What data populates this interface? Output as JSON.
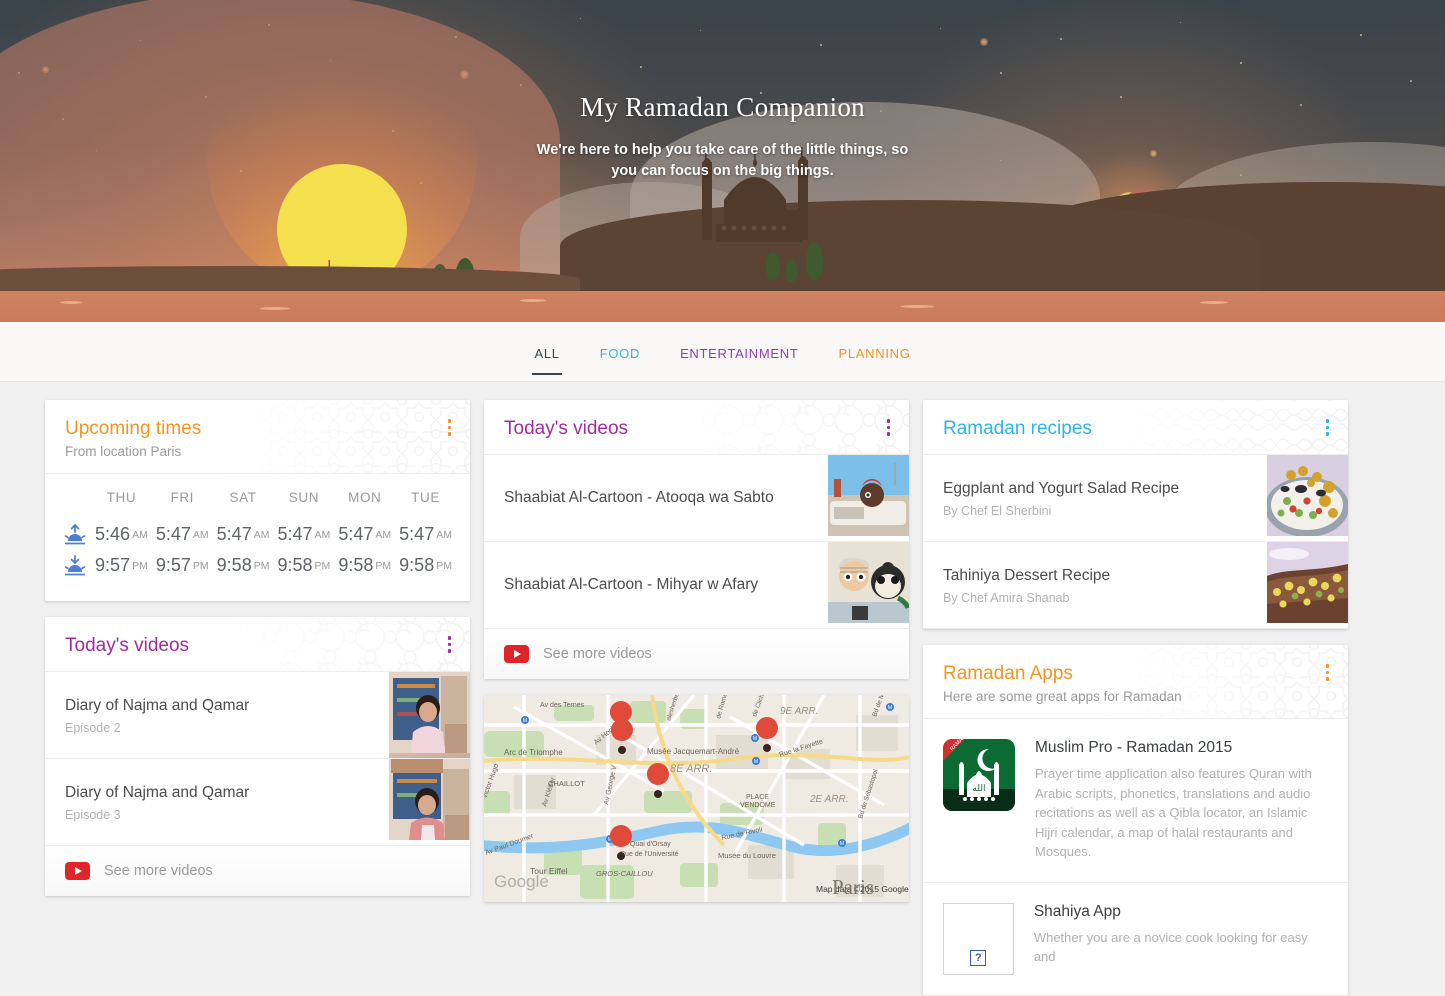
{
  "hero": {
    "title": "My Ramadan Companion",
    "subtitle_line1": "We're here to help you take care of the little things, so",
    "subtitle_line2": "you can focus on the big things."
  },
  "tabs": [
    {
      "label": "ALL",
      "color": "#37474f",
      "active": true
    },
    {
      "label": "FOOD",
      "color": "#29b6d8",
      "active": false
    },
    {
      "label": "ENTERTAINMENT",
      "color": "#8e3fb0",
      "active": false
    },
    {
      "label": "PLANNING",
      "color": "#f5901f",
      "active": false
    }
  ],
  "colors": {
    "orange": "#f5941f",
    "purple": "#a32ba0",
    "cyan": "#29b6e8",
    "dark": "#37474f",
    "youtube_red": "#e0242b"
  },
  "cards": {
    "upcoming_times": {
      "title": "Upcoming times",
      "subtitle": "From location Paris",
      "menu_icon": "kebab-menu-icon",
      "menu_color": "#f5941f",
      "days": [
        "THU",
        "FRI",
        "SAT",
        "SUN",
        "MON",
        "TUE"
      ],
      "rows": [
        {
          "icon": "sunrise-icon",
          "times": [
            "5:46",
            "5:47",
            "5:47",
            "5:47",
            "5:47",
            "5:47"
          ],
          "meridiems": [
            "AM",
            "AM",
            "AM",
            "AM",
            "AM",
            "AM"
          ]
        },
        {
          "icon": "sunset-icon",
          "times": [
            "9:57",
            "9:57",
            "9:58",
            "9:58",
            "9:58",
            "9:58"
          ],
          "meridiems": [
            "PM",
            "PM",
            "PM",
            "PM",
            "PM",
            "PM"
          ]
        }
      ]
    },
    "todays_videos_left": {
      "title": "Today's videos",
      "menu_icon": "kebab-menu-icon",
      "menu_color": "#a32ba0",
      "items": [
        {
          "title": "Diary of Najma and Qamar",
          "subtitle": "Episode 2",
          "thumb": "woman-in-pink-floral-shirt-thumbnail"
        },
        {
          "title": "Diary of Najma and Qamar",
          "subtitle": "Episode 3",
          "thumb": "woman-in-pink-cardigan-thumbnail"
        }
      ],
      "footer_label": "See more videos",
      "footer_icon": "youtube-icon"
    },
    "todays_videos_center": {
      "title": "Today's videos",
      "menu_icon": "kebab-menu-icon",
      "menu_color": "#a32ba0",
      "items": [
        {
          "title": "Shaabiat Al-Cartoon - Atooqa wa Sabto",
          "thumb": "cartoon-characters-in-car-thumbnail"
        },
        {
          "title": "Shaabiat Al-Cartoon - Mihyar w Afary",
          "thumb": "cartoon-boy-and-panda-thumbnail"
        }
      ],
      "footer_label": "See more videos",
      "footer_icon": "youtube-icon"
    },
    "ramadan_recipes": {
      "title": "Ramadan recipes",
      "menu_icon": "kebab-menu-icon",
      "menu_color": "#29b6e8",
      "items": [
        {
          "title": "Eggplant and Yogurt Salad Recipe",
          "subtitle": "By Chef El Sherbini",
          "thumb": "eggplant-yogurt-salad-bowl-thumbnail"
        },
        {
          "title": "Tahiniya Dessert Recipe",
          "subtitle": "By Chef Amira Shanab",
          "thumb": "tahini-dessert-with-pistachio-thumbnail"
        }
      ]
    },
    "ramadan_apps": {
      "title": "Ramadan Apps",
      "subtitle": "Here are some great apps for Ramadan",
      "menu_icon": "kebab-menu-icon",
      "menu_color": "#f5941f",
      "items": [
        {
          "name": "Muslim Pro - Ramadan 2015",
          "description": "Prayer time application also features Quran with Arabic scripts, phonetics, translations and audio recitations as well as a Qibla locator, an Islamic Hijri calendar, a map of halal restaurants and Mosques.",
          "icon": "muslim-pro-mosque-app-icon",
          "ribbon": "RAMADAN"
        },
        {
          "name": "Shahiya App",
          "description": "Whether you are a novice cook looking for easy and",
          "icon": "broken-image-placeholder-icon"
        }
      ]
    },
    "map": {
      "name": "paris-locations-map",
      "attribution": "Map data ©2015 Google",
      "logo": "Google",
      "city_label": "Paris",
      "labels": [
        "Av des Ternes",
        "Arc de Triomphe",
        "Musée Jacquemart-André",
        "8E ARR.",
        "9E ARR.",
        "2E ARR.",
        "CHAILLOT",
        "Victor Hugo",
        "Av Kléber",
        "Av George V",
        "Av Hoche",
        "Rue la Fayette",
        "PLACE VENDÔME",
        "Rue de Rivoli",
        "Quai d'Orsay",
        "Rue de l'Université",
        "Musée du Louvre",
        "Tour Eiffel",
        "GROS-CAILLOU",
        "Av Paul Doumer",
        "Bd de Sébastopol",
        "Bd de Magenta",
        "de Clichy",
        "de Rome",
        "alesherbes"
      ],
      "marker_count": 5
    }
  }
}
